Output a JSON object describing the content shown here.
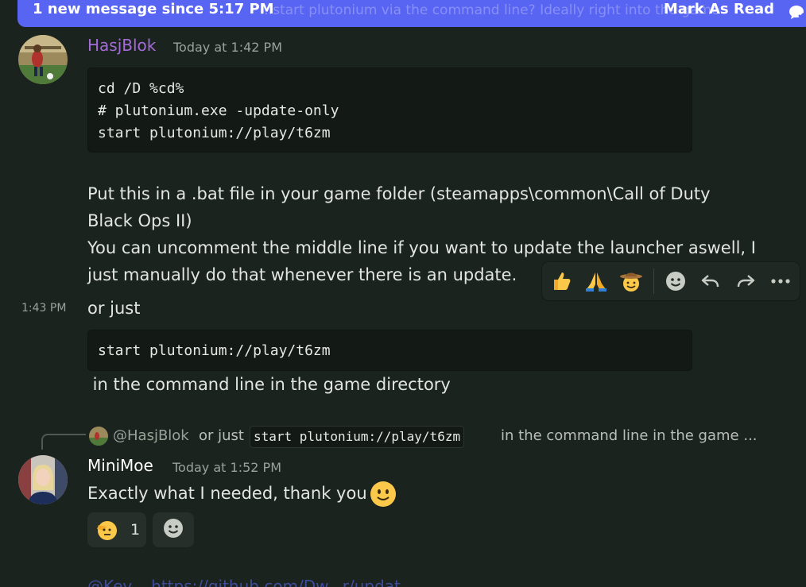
{
  "banner": {
    "text": "1 new message since 5:17 PM",
    "ghost_text": "...start plutonium via the command line? Ideally right into the game",
    "mark_label": "Mark As Read"
  },
  "messages": [
    {
      "author": "HasjBlok",
      "author_color": "#a46bd8",
      "time": "Today at 1:42 PM",
      "code": [
        "cd /D %cd%",
        "# plutonium.exe -update-only",
        "start plutonium://play/t6zm"
      ],
      "text_lines": [
        "Put this in a .bat file in your game folder (steamapps\\common\\Call of Duty",
        "Black Ops II)",
        "You can uncomment the middle line if you want to update the launcher aswell, I",
        "just manually do that whenever there is an update."
      ]
    },
    {
      "side_time": "1:43 PM",
      "text": "or just",
      "code": [
        "start plutonium://play/t6zm"
      ],
      "after_text": " in the command line in the game directory"
    }
  ],
  "toolbar": {
    "icons": [
      "thumbs-up-icon",
      "pray-icon",
      "cowboy-icon",
      "add-reaction-icon",
      "reply-icon",
      "forward-icon",
      "more-icon"
    ]
  },
  "reply": {
    "mention": "@HasjBlok",
    "text_before": "or just",
    "code": "start plutonium://play/t6zm",
    "text_after": "in the command line in the game ..."
  },
  "reply_message": {
    "author": "MiniMoe",
    "time": "Today at 1:52 PM",
    "text": "Exactly what I needed, thank you",
    "reactions": [
      {
        "icon": "saluting-face-icon",
        "count": "1"
      }
    ]
  },
  "bottom_ghost": "@Kev... https://github.com/Dw...r/updat..."
}
